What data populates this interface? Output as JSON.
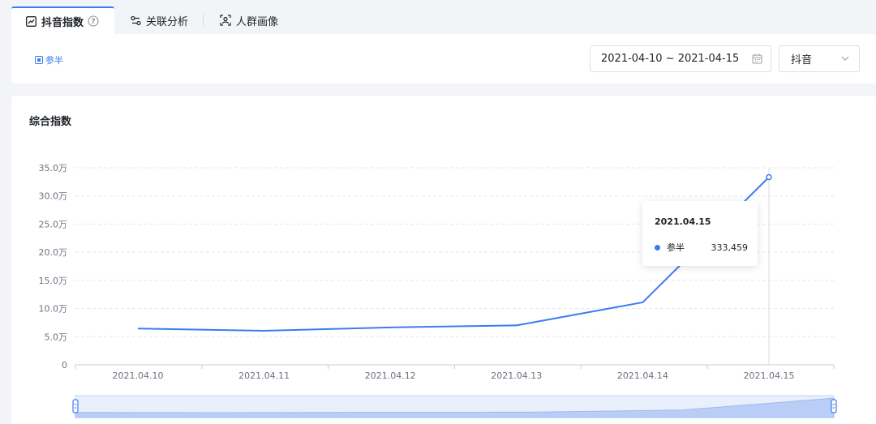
{
  "tabs": [
    {
      "label": "抖音指数",
      "active": true
    },
    {
      "label": "关联分析",
      "active": false
    },
    {
      "label": "人群画像",
      "active": false
    }
  ],
  "filter": {
    "legend_label": "参半",
    "date_range": "2021-04-10 ~ 2021-04-15",
    "platform": "抖音"
  },
  "chart_title": "综合指数",
  "chart_data": {
    "type": "line",
    "title": "综合指数",
    "x": [
      "2021.04.10",
      "2021.04.11",
      "2021.04.12",
      "2021.04.13",
      "2021.04.14",
      "2021.04.15"
    ],
    "y_ticks": [
      "0",
      "5.0万",
      "10.0万",
      "15.0万",
      "20.0万",
      "25.0万",
      "30.0万",
      "35.0万"
    ],
    "ylim": [
      0,
      350000
    ],
    "grid": true,
    "series": [
      {
        "name": "参半",
        "color": "#3b7cf0",
        "values": [
          64500,
          60500,
          66500,
          70000,
          111000,
          333459
        ]
      }
    ]
  },
  "tooltip": {
    "date": "2021.04.15",
    "series_name": "参半",
    "value": "333,459"
  },
  "colors": {
    "accent": "#3b7cf0"
  }
}
